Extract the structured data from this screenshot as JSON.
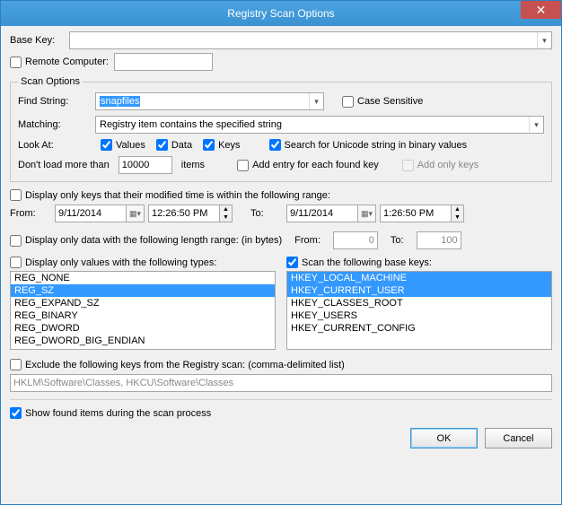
{
  "title": "Registry Scan Options",
  "baseKey": {
    "label": "Base Key:",
    "value": ""
  },
  "remote": {
    "label": "Remote Computer:",
    "checked": false,
    "value": ""
  },
  "scanOptions": {
    "legend": "Scan Options",
    "findString": {
      "label": "Find String:",
      "value": "snapfiles"
    },
    "caseSensitive": {
      "label": "Case Sensitive",
      "checked": false
    },
    "matching": {
      "label": "Matching:",
      "value": "Registry item contains the specified string"
    },
    "lookAt": {
      "label": "Look At:",
      "values": {
        "label": "Values",
        "checked": true
      },
      "data": {
        "label": "Data",
        "checked": true
      },
      "keys": {
        "label": "Keys",
        "checked": true
      },
      "unicode": {
        "label": "Search for Unicode string in binary values",
        "checked": true
      }
    },
    "dontLoad": {
      "prefix": "Don't load more than",
      "value": "10000",
      "suffix": "items"
    },
    "addEntry": {
      "label": "Add entry for each found key",
      "checked": false
    },
    "addOnlyKeys": {
      "label": "Add only keys",
      "checked": false
    }
  },
  "timeRange": {
    "label": "Display only keys that their modified time is within the following range:",
    "checked": false,
    "fromLabel": "From:",
    "fromDate": "9/11/2014",
    "fromTime": "12:26:50 PM",
    "toLabel": "To:",
    "toDate": "9/11/2014",
    "toTime": "1:26:50 PM"
  },
  "lengthRange": {
    "label": "Display only data with the following length range: (in bytes)",
    "checked": false,
    "fromLabel": "From:",
    "fromVal": "0",
    "toLabel": "To:",
    "toVal": "100"
  },
  "valueTypes": {
    "label": "Display only values with the following types:",
    "checked": false,
    "items": [
      {
        "t": "REG_NONE",
        "sel": false
      },
      {
        "t": "REG_SZ",
        "sel": true
      },
      {
        "t": "REG_EXPAND_SZ",
        "sel": false
      },
      {
        "t": "REG_BINARY",
        "sel": false
      },
      {
        "t": "REG_DWORD",
        "sel": false
      },
      {
        "t": "REG_DWORD_BIG_ENDIAN",
        "sel": false
      }
    ]
  },
  "baseKeys": {
    "label": "Scan the following base keys:",
    "checked": true,
    "items": [
      {
        "t": "HKEY_LOCAL_MACHINE",
        "sel": true
      },
      {
        "t": "HKEY_CURRENT_USER",
        "sel": true
      },
      {
        "t": "HKEY_CLASSES_ROOT",
        "sel": false
      },
      {
        "t": "HKEY_USERS",
        "sel": false
      },
      {
        "t": "HKEY_CURRENT_CONFIG",
        "sel": false
      }
    ]
  },
  "exclude": {
    "label": "Exclude the following keys from the Registry scan: (comma-delimited list)",
    "checked": false,
    "value": "HKLM\\Software\\Classes, HKCU\\Software\\Classes"
  },
  "showFound": {
    "label": "Show found items during the scan process",
    "checked": true
  },
  "buttons": {
    "ok": "OK",
    "cancel": "Cancel"
  }
}
